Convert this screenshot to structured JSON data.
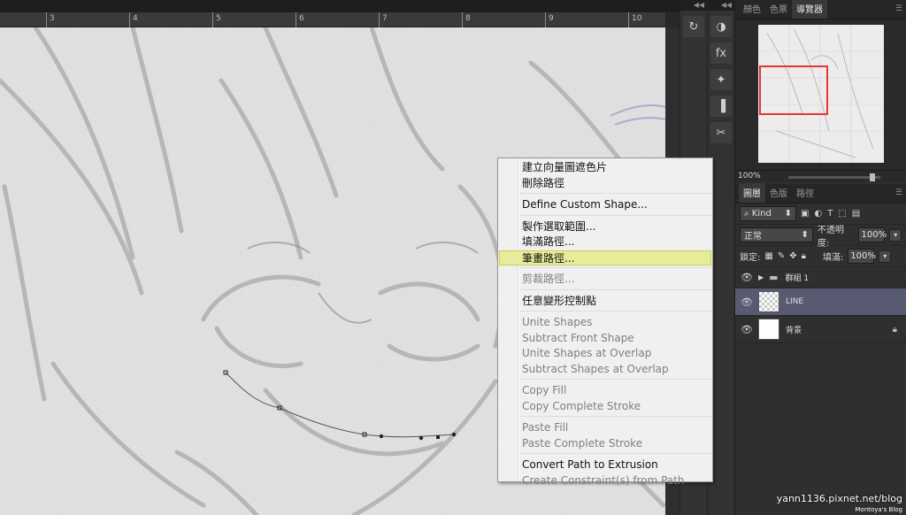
{
  "ruler": {
    "ticks": [
      "3",
      "4",
      "5",
      "6",
      "7",
      "8",
      "9",
      "10"
    ]
  },
  "strip_head": "◀◀",
  "tools_col1": [
    {
      "icon": "history-icon",
      "glyph": "↻"
    }
  ],
  "tools_col2": [
    {
      "icon": "adjustments-icon",
      "glyph": "◑"
    },
    {
      "icon": "styles-fx-icon",
      "glyph": "fx"
    },
    {
      "icon": "brush-presets-icon",
      "glyph": "✦"
    },
    {
      "icon": "clone-source-icon",
      "glyph": "▐"
    },
    {
      "icon": "tool-presets-icon",
      "glyph": "✂"
    }
  ],
  "navigator": {
    "tabs": [
      "顏色",
      "色票",
      "導覽器"
    ],
    "active_tab": 2,
    "zoom": "100%"
  },
  "layers_panel": {
    "tabs": [
      "圖層",
      "色版",
      "路徑"
    ],
    "active_tab": 0,
    "kind_label": "Kind",
    "filter_icons": [
      "image-filter-icon",
      "adjust-filter-icon",
      "type-filter-icon",
      "shape-filter-icon",
      "smart-filter-icon"
    ],
    "blend_mode": "正常",
    "opacity_label": "不透明度:",
    "opacity_value": "100%",
    "lock_label": "鎖定:",
    "fill_label": "填滿:",
    "fill_value": "100%",
    "layers": [
      {
        "name": "群組 1",
        "type": "group",
        "selected": false
      },
      {
        "name": "LINE",
        "type": "transparent",
        "selected": true
      },
      {
        "name": "背景",
        "type": "background",
        "selected": false,
        "locked": true
      }
    ]
  },
  "context_menu": {
    "groups": [
      [
        {
          "label": "建立向量圖遮色片",
          "enabled": true
        },
        {
          "label": "刪除路徑",
          "enabled": true
        }
      ],
      [
        {
          "label": "Define Custom Shape...",
          "enabled": true
        }
      ],
      [
        {
          "label": "製作選取範圍...",
          "enabled": true
        },
        {
          "label": "填滿路徑...",
          "enabled": true
        },
        {
          "label": "筆畫路徑...",
          "enabled": true,
          "hover": true
        }
      ],
      [
        {
          "label": "剪裁路徑...",
          "enabled": false
        }
      ],
      [
        {
          "label": "任意變形控制點",
          "enabled": true
        }
      ],
      [
        {
          "label": "Unite Shapes",
          "enabled": false
        },
        {
          "label": "Subtract Front Shape",
          "enabled": false
        },
        {
          "label": "Unite Shapes at Overlap",
          "enabled": false
        },
        {
          "label": "Subtract Shapes at Overlap",
          "enabled": false
        }
      ],
      [
        {
          "label": "Copy Fill",
          "enabled": false
        },
        {
          "label": "Copy Complete Stroke",
          "enabled": false
        }
      ],
      [
        {
          "label": "Paste Fill",
          "enabled": false
        },
        {
          "label": "Paste Complete Stroke",
          "enabled": false
        }
      ],
      [
        {
          "label": "Convert Path to Extrusion",
          "enabled": true
        },
        {
          "label": "Create Constraint(s) from Path",
          "enabled": false
        }
      ]
    ]
  },
  "watermark": {
    "url": "yann1136.pixnet.net/blog",
    "sub": "Montoya's  Blog"
  }
}
